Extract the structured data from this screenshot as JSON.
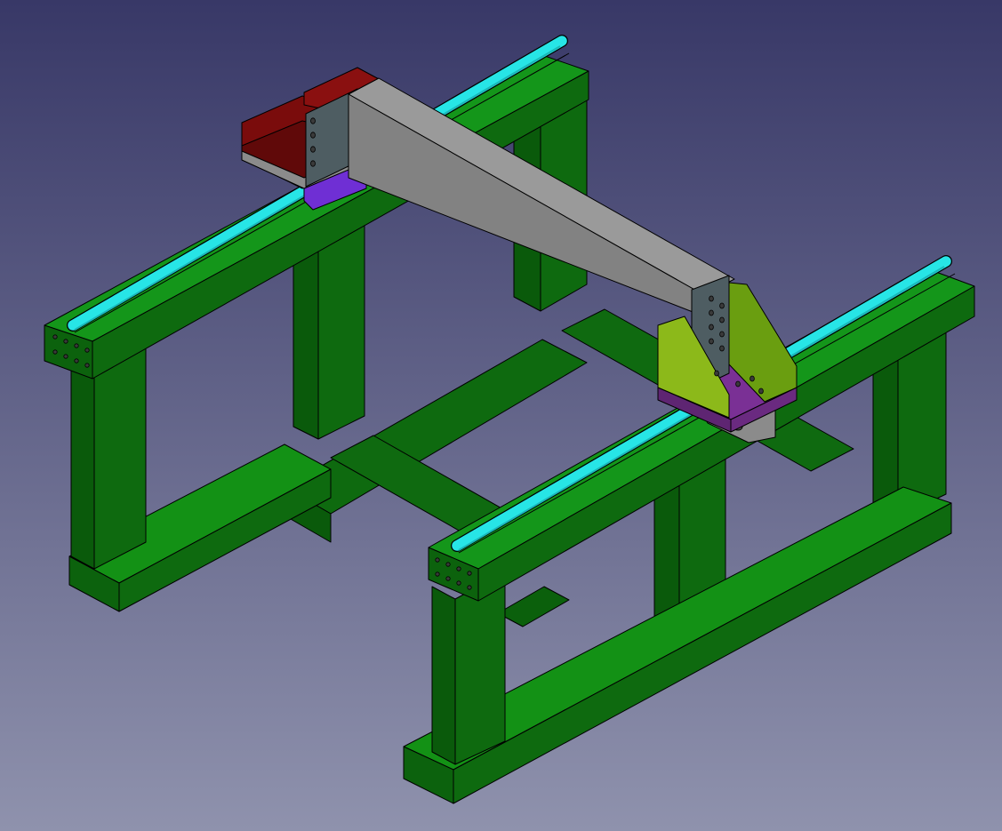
{
  "viewer": {
    "background_top": "#383867",
    "background_bottom": "#8f92ad"
  },
  "model": {
    "parts": [
      {
        "name": "frame",
        "color": "#0f6a10"
      },
      {
        "name": "linear-rails",
        "color": "#27e5e6"
      },
      {
        "name": "gantry-beam",
        "color": "#828282"
      },
      {
        "name": "carriage-bracket-left",
        "color": "#7a0c0c"
      },
      {
        "name": "carriage-bracket-right",
        "color": "#6a9e10"
      },
      {
        "name": "end-plates",
        "color": "#4e5d62"
      },
      {
        "name": "carriage-blocks",
        "color": "#7a3095"
      }
    ]
  }
}
